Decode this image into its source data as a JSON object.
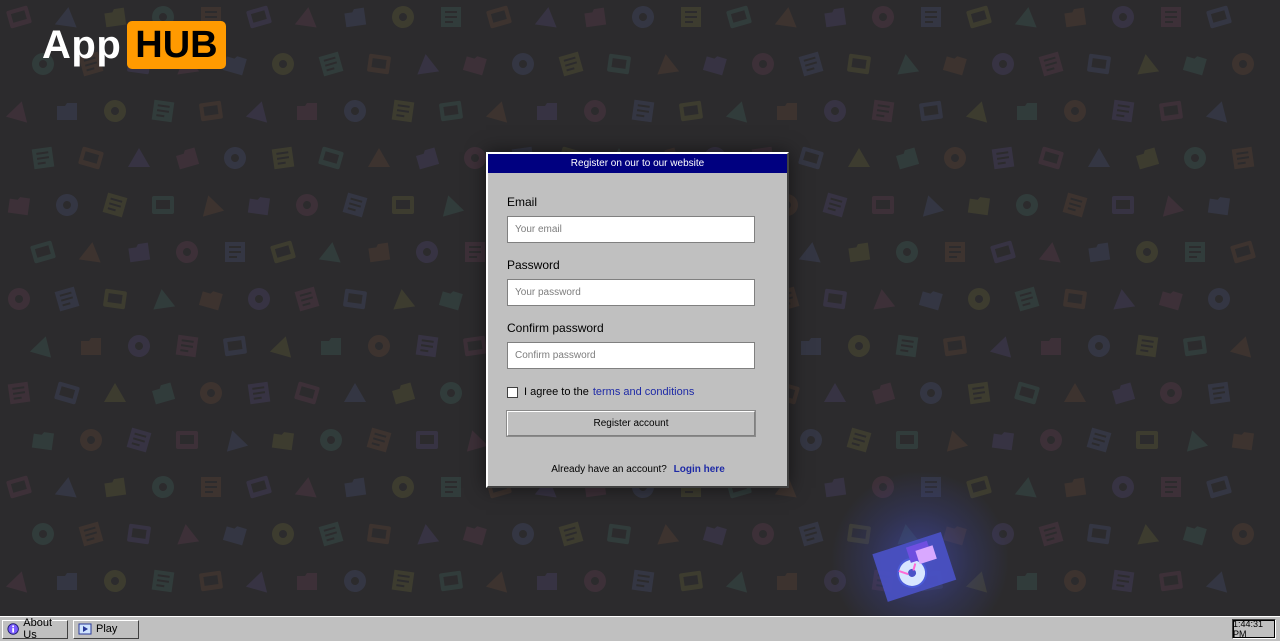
{
  "logo": {
    "app": "App",
    "hub": "HUB"
  },
  "dialog": {
    "title": "Register on our to our website",
    "email": {
      "label": "Email",
      "placeholder": "Your email",
      "value": ""
    },
    "password": {
      "label": "Password",
      "placeholder": "Your password",
      "value": ""
    },
    "confirm": {
      "label": "Confirm password",
      "placeholder": "Confirm password",
      "value": ""
    },
    "agree": {
      "prefix": "I agree to the",
      "link": "terms and conditions",
      "checked": false
    },
    "register_label": "Register account",
    "login_prompt": "Already have an account?",
    "login_link": "Login here"
  },
  "taskbar": {
    "items": [
      {
        "label": "About Us",
        "icon": "about-icon"
      },
      {
        "label": "Play",
        "icon": "play-icon"
      }
    ],
    "clock": "1:44:31 PM"
  },
  "colors": {
    "background": "#2c2b2d",
    "titlebar": "#000080",
    "hub_orange": "#ff9a00",
    "window_gray": "#c0c0c0",
    "link_blue": "#1e2aa6"
  }
}
